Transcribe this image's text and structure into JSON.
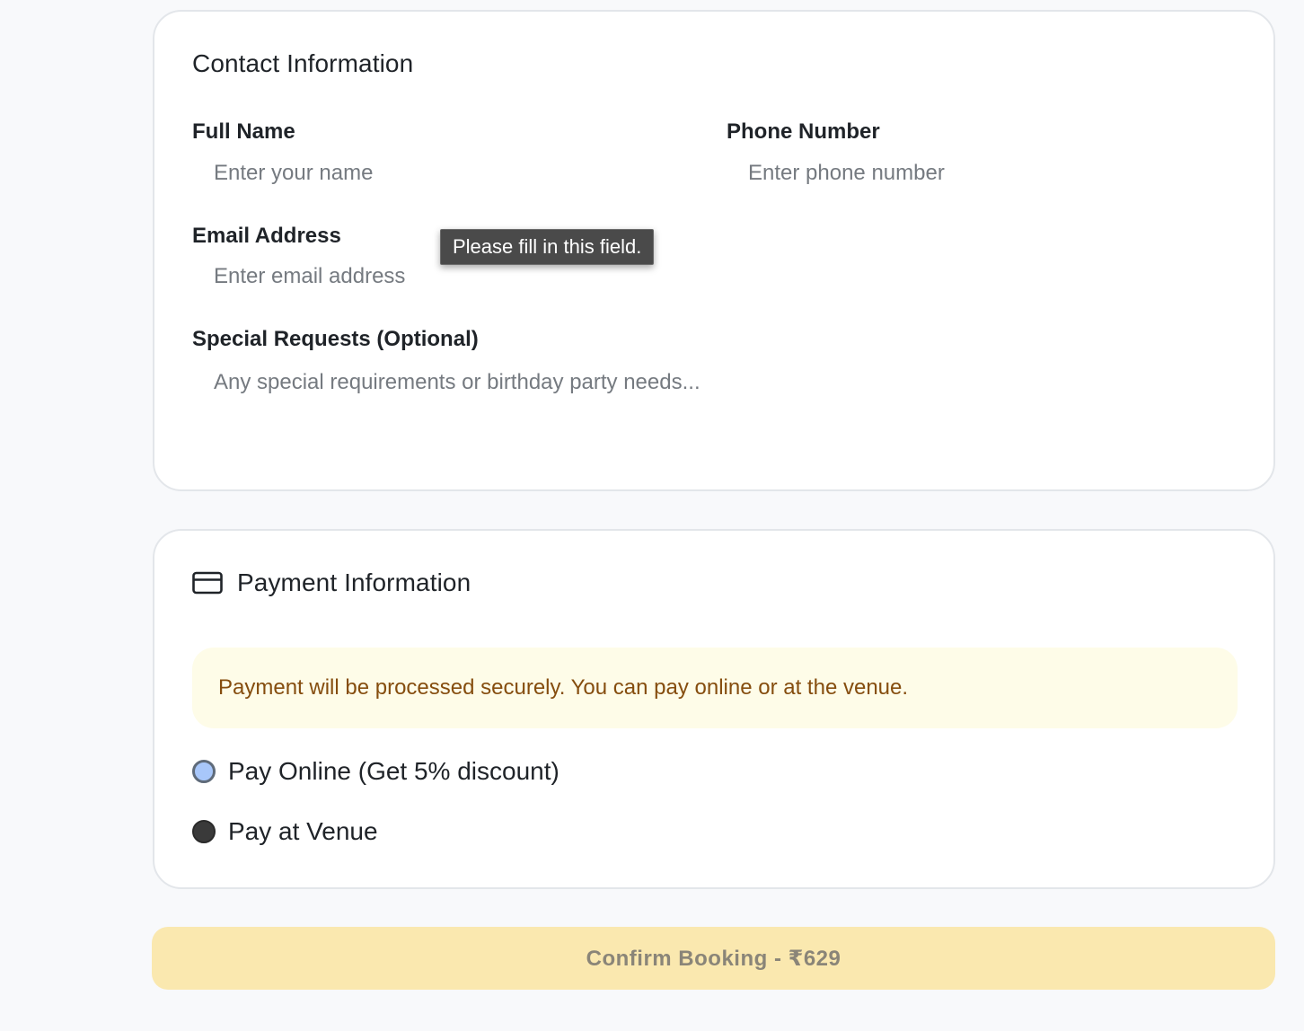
{
  "contact": {
    "title": "Contact Information",
    "full_name": {
      "label": "Full Name",
      "placeholder": "Enter your name",
      "value": ""
    },
    "phone": {
      "label": "Phone Number",
      "placeholder": "Enter phone number",
      "value": ""
    },
    "email": {
      "label": "Email Address",
      "placeholder": "Enter email address",
      "value": ""
    },
    "special_requests": {
      "label": "Special Requests (Optional)",
      "placeholder": "Any special requirements or birthday party needs...",
      "value": ""
    },
    "validation_tooltip": "Please fill in this field."
  },
  "payment": {
    "title": "Payment Information",
    "icon": "credit-card-icon",
    "notice": "Payment will be processed securely. You can pay online or at the venue.",
    "options": [
      {
        "label": "Pay Online (Get 5% discount)",
        "selected": true
      },
      {
        "label": "Pay at Venue",
        "selected": false
      }
    ]
  },
  "confirm_button": {
    "label": "Confirm Booking - ₹629",
    "disabled": true
  },
  "colors": {
    "page_bg": "#f8f9fb",
    "card_border": "#e3e6ea",
    "notice_bg": "#fefce8",
    "notice_text": "#854d0e",
    "button_bg": "#fae8af",
    "button_text": "#8a8578",
    "radio_selected": "#a8c7fa"
  }
}
